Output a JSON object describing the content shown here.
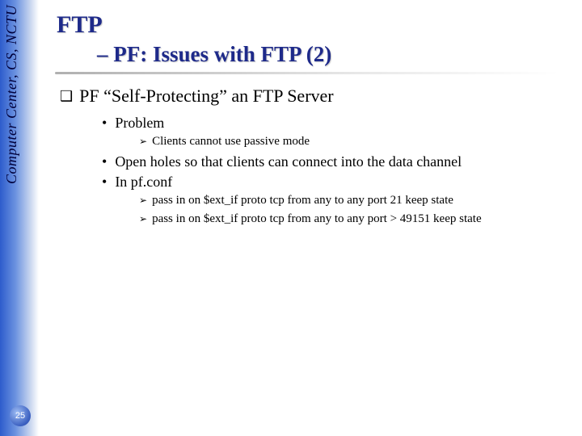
{
  "sidebar": {
    "org_text": "Computer Center, CS, NCTU"
  },
  "page_number": "25",
  "title": {
    "main": "FTP",
    "sub": "– PF: Issues with FTP (2)"
  },
  "heading": "PF “Self-Protecting” an FTP Server",
  "bullets": {
    "problem": "Problem",
    "problem_sub": "Clients cannot use passive mode",
    "open_holes": "Open holes so that clients can connect into the data channel",
    "in_pfconf": "In pf.conf",
    "rule1": "pass in on $ext_if proto tcp from any to any port 21 keep state",
    "rule2": "pass in on $ext_if proto tcp from any to any port > 49151 keep state"
  }
}
